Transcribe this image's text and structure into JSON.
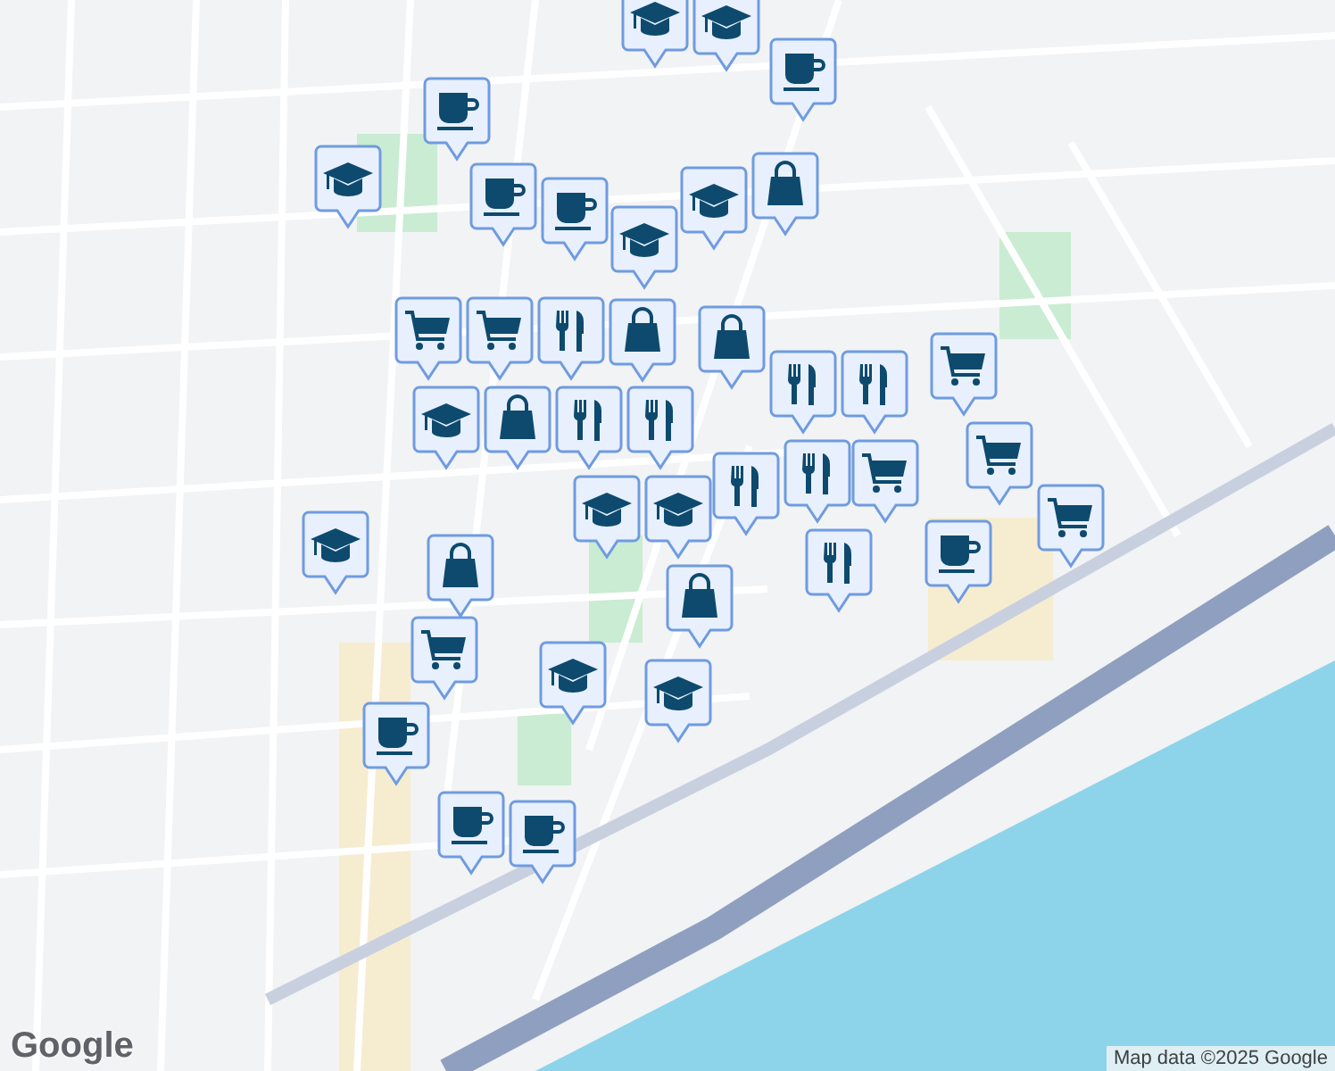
{
  "map": {
    "pins": [
      {
        "kind": "school"
      },
      {
        "kind": "school"
      },
      {
        "kind": "coffee"
      },
      {
        "kind": "coffee"
      },
      {
        "kind": "school"
      },
      {
        "kind": "coffee"
      },
      {
        "kind": "coffee"
      },
      {
        "kind": "school"
      },
      {
        "kind": "shopping"
      },
      {
        "kind": "school"
      },
      {
        "kind": "shopping"
      },
      {
        "kind": "cart"
      },
      {
        "kind": "restaurant"
      },
      {
        "kind": "shopping"
      },
      {
        "kind": "cart"
      },
      {
        "kind": "cart"
      },
      {
        "kind": "shopping"
      },
      {
        "kind": "restaurant"
      },
      {
        "kind": "restaurant"
      },
      {
        "kind": "restaurant"
      },
      {
        "kind": "restaurant"
      },
      {
        "kind": "restaurant"
      },
      {
        "kind": "cart"
      },
      {
        "kind": "school"
      },
      {
        "kind": "school"
      },
      {
        "kind": "restaurant"
      },
      {
        "kind": "school"
      },
      {
        "kind": "shopping"
      },
      {
        "kind": "cart"
      },
      {
        "kind": "cart"
      },
      {
        "kind": "restaurant"
      },
      {
        "kind": "coffee"
      },
      {
        "kind": "school"
      },
      {
        "kind": "shopping"
      },
      {
        "kind": "cart"
      },
      {
        "kind": "school"
      },
      {
        "kind": "school"
      },
      {
        "kind": "coffee"
      },
      {
        "kind": "coffee"
      },
      {
        "kind": "coffee"
      }
    ]
  },
  "logo": "Google",
  "attribution": "Map data ©2025 Google"
}
